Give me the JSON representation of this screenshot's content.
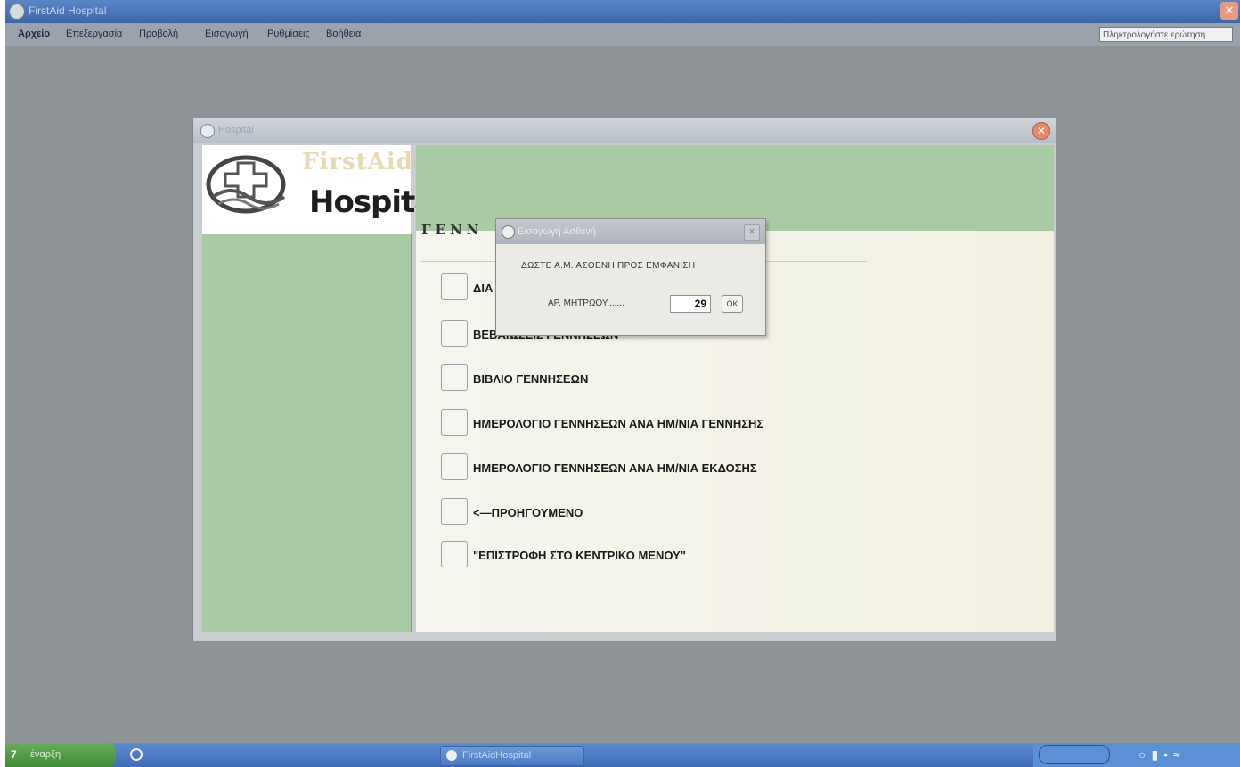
{
  "app": {
    "title": "FirstAid Hospital",
    "menu": [
      "Αρχείο",
      "Επεξεργασία",
      "Προβολή",
      "Εισαγωγή",
      "Ρυθμίσεις",
      "Βοήθεια"
    ],
    "language_box": "Πληκτρολογήστε ερώτηση"
  },
  "window": {
    "title": "Hospital",
    "logo_firstaid": "FirstAid",
    "logo_hospital": "Hospital",
    "heading": "ΓΕΝΝ"
  },
  "menu_rows": [
    {
      "label": "ΔΙΑ"
    },
    {
      "label": "ΒΕΒΑΙΩΣΕΙΣ ΓΕΝΝΗΣΕΩΝ"
    },
    {
      "label": "ΒΙΒΛΙΟ ΓΕΝΝΗΣΕΩΝ"
    },
    {
      "label": "ΗΜΕΡΟΛΟΓΙΟ ΓΕΝΝΗΣΕΩΝ ΑΝΑ ΗΜ/ΝΙΑ ΓΕΝΝΗΣΗΣ"
    },
    {
      "label": "ΗΜΕΡΟΛΟΓΙΟ ΓΕΝΝΗΣΕΩΝ ΑΝΑ ΗΜ/ΝΙΑ  ΕΚΔΟΣΗΣ"
    },
    {
      "label": "<—ΠΡΟΗΓΟΥΜΕΝΟ"
    },
    {
      "label": "\"ΕΠΙΣΤΡΟΦΗ ΣΤΟ ΚΕΝΤΡΙΚΟ ΜΕΝΟΥ\""
    }
  ],
  "dialog": {
    "title": "Εισαγωγή Ασθενή",
    "prompt": "ΔΩΣΤΕ Α.Μ. ΑΣΘΕΝΗ ΠΡΟΣ ΕΜΦΑΝΙΣΗ",
    "field_label": "ΑΡ. ΜΗΤΡΩΟΥ.......",
    "field_value": "29",
    "ok_label": "OK"
  },
  "taskbar": {
    "start_num": "7",
    "start_label": "έναρξη",
    "task_label": "FirstAidHospital"
  },
  "colors": {
    "green_panel": "#a9cba3",
    "content_bg": "#f5f5ee",
    "desktop": "#8e9396"
  }
}
